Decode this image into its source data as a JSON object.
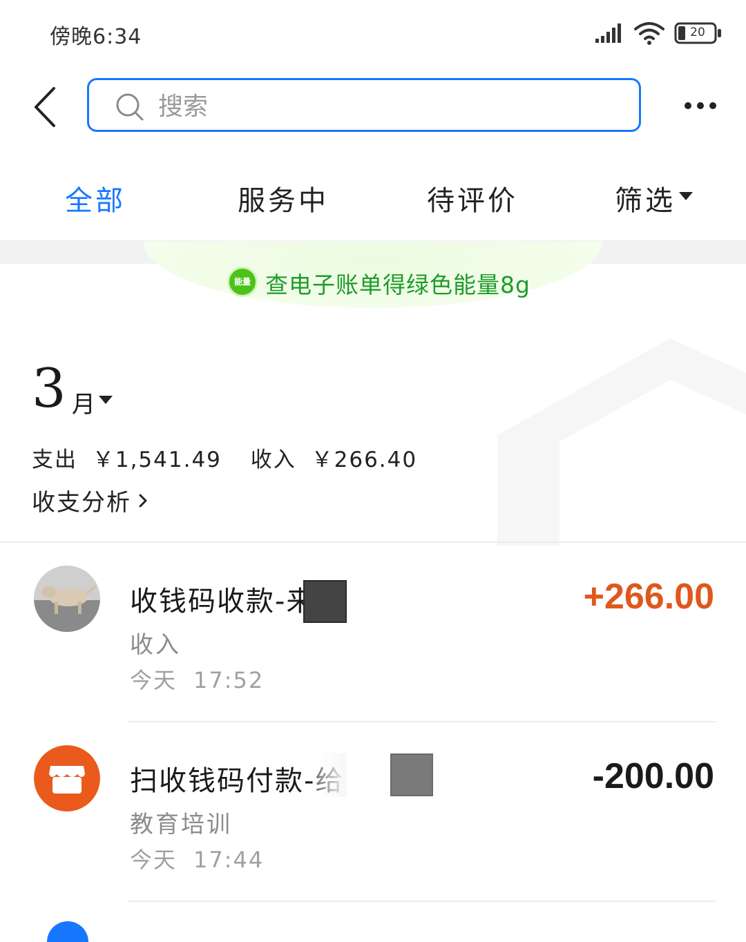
{
  "status_bar": {
    "time": "傍晚6:34",
    "battery": "20",
    "icons": [
      "signal-icon",
      "wifi-icon",
      "battery-icon"
    ]
  },
  "top_bar": {
    "back_icon": "chevron-left-icon",
    "search_placeholder": "搜索",
    "more_icon": "more-horizontal-icon"
  },
  "tabs": [
    {
      "label": "全部",
      "active": true
    },
    {
      "label": "服务中",
      "active": false
    },
    {
      "label": "待评价",
      "active": false
    },
    {
      "label": "筛选",
      "active": false
    }
  ],
  "energy_banner": {
    "badge": "能量",
    "text": "查电子账单得绿色能量8g"
  },
  "month_section": {
    "month_number": "3",
    "month_unit": "月",
    "expense_label": "支出",
    "expense_value": "￥1,541.49",
    "income_label": "收入",
    "income_value": "￥266.40",
    "analysis_link": "收支分析"
  },
  "transactions": [
    {
      "title": "收钱码收款-来",
      "category": "收入",
      "day": "今天",
      "time": "17:52",
      "amount": "+266.00",
      "avatar": "dog-photo-avatar"
    },
    {
      "title": "扫收钱码付款-给",
      "category": "教育培训",
      "day": "今天",
      "time": "17:44",
      "amount": "-200.00",
      "avatar": "store-icon"
    }
  ],
  "colors": {
    "accent": "#1677ff",
    "income_amount": "#e0571d",
    "expense_amount": "#1a1a1a",
    "energy_green": "#1f9b2a",
    "store_avatar": "#ea5a1c"
  }
}
